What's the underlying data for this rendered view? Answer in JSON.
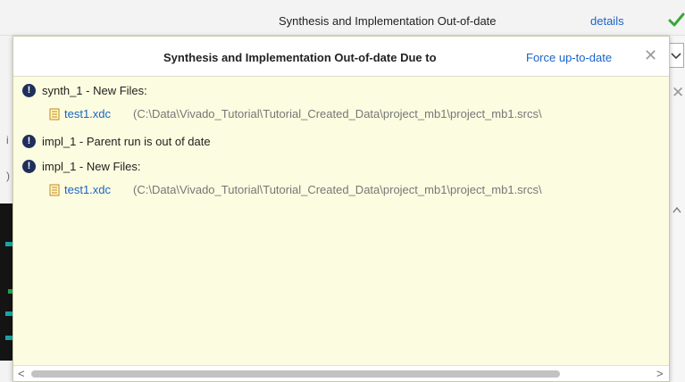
{
  "topbar": {
    "status_text": "Synthesis and Implementation Out-of-date",
    "details_link": "details",
    "check_icon": "checkmark-icon",
    "check_color": "#3aa63a"
  },
  "popup": {
    "title": "Synthesis and Implementation Out-of-date Due to",
    "force_link": "Force up-to-date",
    "close_icon": "close-icon",
    "items": [
      {
        "label": "synth_1 - New Files:",
        "icon": "warning-icon"
      },
      {
        "file": "test1.xdc",
        "path": "(C:\\Data\\Vivado_Tutorial\\Tutorial_Created_Data\\project_mb1\\project_mb1.srcs\\"
      },
      {
        "label": "impl_1 - Parent run is out of date",
        "icon": "warning-icon"
      },
      {
        "label": "impl_1 - New Files:",
        "icon": "warning-icon"
      },
      {
        "file": "test1.xdc",
        "path": "(C:\\Data\\Vivado_Tutorial\\Tutorial_Created_Data\\project_mb1\\project_mb1.srcs\\"
      }
    ],
    "scrollbar": {
      "left_arrow": "<",
      "right_arrow": ">"
    }
  },
  "colors": {
    "popup_bg": "#fcfce0",
    "link": "#1a63c8",
    "warning_icon": "#1f2f5c"
  }
}
